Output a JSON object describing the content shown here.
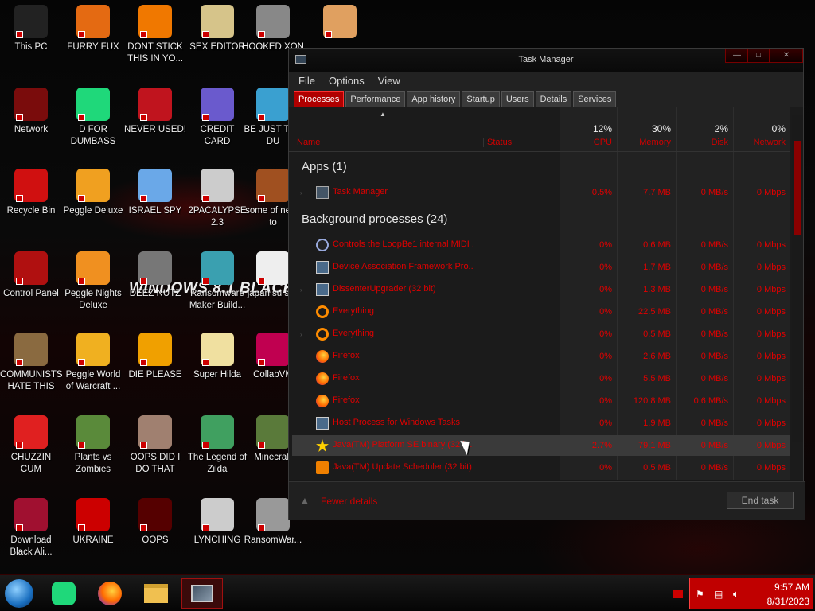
{
  "desktop": {
    "icons": [
      {
        "label": "This PC",
        "col": "#222"
      },
      {
        "label": "FURRY FUX",
        "col": "#e46a12"
      },
      {
        "label": "DONT STICK THIS IN YO...",
        "col": "#f07800"
      },
      {
        "label": "SEX EDITOR",
        "col": "#d6c48a"
      },
      {
        "label": "HOOKED XON",
        "col": "#888"
      },
      {
        "label": "",
        "col": "#e0a060"
      },
      {
        "label": "Network",
        "col": "#7a0c0c"
      },
      {
        "label": "D FOR DUMBASS",
        "col": "#1fd87a"
      },
      {
        "label": "NEVER USED!",
        "col": "#c0141e"
      },
      {
        "label": "CREDIT CARD CHECKER",
        "col": "#6a5acd"
      },
      {
        "label": "BE JUST THE DU",
        "col": "#3aa0d0"
      },
      {
        "label": "Recycle Bin",
        "col": "#d01010"
      },
      {
        "label": "Peggle Deluxe",
        "col": "#f0a020"
      },
      {
        "label": "ISRAEL SPY",
        "col": "#6aa8e8"
      },
      {
        "label": "2PACALYPSE 2.3",
        "col": "#ccc"
      },
      {
        "label": "some of need to",
        "col": "#a05020"
      },
      {
        "label": "Control Panel",
        "col": "#b01010"
      },
      {
        "label": "Peggle Nights Deluxe",
        "col": "#f09020"
      },
      {
        "label": "DEEZ NUTZ",
        "col": "#777"
      },
      {
        "label": "Ransomware Maker Build...",
        "col": "#3aa0b0"
      },
      {
        "label": "japan su sim",
        "col": "#eee"
      },
      {
        "label": "COMMUNISTS HATE THIS G...",
        "col": "#8a6a40"
      },
      {
        "label": "Peggle World of Warcraft ...",
        "col": "#f0b020"
      },
      {
        "label": "DIE PLEASE",
        "col": "#f0a000"
      },
      {
        "label": "Super Hilda",
        "col": "#f0e0a0"
      },
      {
        "label": "CollabVM",
        "col": "#c00050"
      },
      {
        "label": "CHUZZIN CUM",
        "col": "#e02020"
      },
      {
        "label": "Plants vs Zombies",
        "col": "#5a8a3a"
      },
      {
        "label": "OOPS DID I DO THAT",
        "col": "#a08070"
      },
      {
        "label": "The Legend of Zilda",
        "col": "#40a060"
      },
      {
        "label": "Minecraft",
        "col": "#5a7a3a"
      },
      {
        "label": "Download Black Ali...",
        "col": "#a01030"
      },
      {
        "label": "UKRAINE",
        "col": "#c00"
      },
      {
        "label": "OOPS",
        "col": "#500"
      },
      {
        "label": "LYNCHING",
        "col": "#ccc"
      },
      {
        "label": "RansomWar...",
        "col": "#999"
      }
    ],
    "wallpaper_text": "WiNDOWS 8.1 BLACK E"
  },
  "taskmanager": {
    "title": "Task Manager",
    "window_buttons": {
      "min": "—",
      "max": "□",
      "close": "✕"
    },
    "menu": [
      "File",
      "Options",
      "View"
    ],
    "tabs": [
      "Processes",
      "Performance",
      "App history",
      "Startup",
      "Users",
      "Details",
      "Services"
    ],
    "columns": {
      "name": "Name",
      "status": "Status",
      "cpu_pct": "12%",
      "cpu": "CPU",
      "mem_pct": "30%",
      "mem": "Memory",
      "disk_pct": "2%",
      "disk": "Disk",
      "net_pct": "0%",
      "net": "Network"
    },
    "sort_arrow": "▲",
    "apps_header": "Apps (1)",
    "bg_header": "Background processes (24)",
    "apps": [
      {
        "name": "Task Manager",
        "cpu": "0.5%",
        "mem": "7.7 MB",
        "disk": "0 MB/s",
        "net": "0 Mbps",
        "icon": "tm",
        "exp": true
      }
    ],
    "bg": [
      {
        "name": "Controls the LoopBe1 internal MIDI ...",
        "cpu": "0%",
        "mem": "0.6 MB",
        "disk": "0 MB/s",
        "net": "0 Mbps",
        "icon": "midi",
        "exp": false
      },
      {
        "name": "Device Association Framework Pro...",
        "cpu": "0%",
        "mem": "1.7 MB",
        "disk": "0 MB/s",
        "net": "0 Mbps",
        "icon": "win",
        "exp": false
      },
      {
        "name": "DissenterUpgrader (32 bit)",
        "cpu": "0%",
        "mem": "1.3 MB",
        "disk": "0 MB/s",
        "net": "0 Mbps",
        "icon": "win",
        "exp": true
      },
      {
        "name": "Everything",
        "cpu": "0%",
        "mem": "22.5 MB",
        "disk": "0 MB/s",
        "net": "0 Mbps",
        "icon": "search",
        "exp": false
      },
      {
        "name": "Everything",
        "cpu": "0%",
        "mem": "0.5 MB",
        "disk": "0 MB/s",
        "net": "0 Mbps",
        "icon": "search",
        "exp": true
      },
      {
        "name": "Firefox",
        "cpu": "0%",
        "mem": "2.6 MB",
        "disk": "0 MB/s",
        "net": "0 Mbps",
        "icon": "ff",
        "exp": false
      },
      {
        "name": "Firefox",
        "cpu": "0%",
        "mem": "5.5 MB",
        "disk": "0 MB/s",
        "net": "0 Mbps",
        "icon": "ff",
        "exp": false
      },
      {
        "name": "Firefox",
        "cpu": "0%",
        "mem": "120.8 MB",
        "disk": "0.6 MB/s",
        "net": "0 Mbps",
        "icon": "ff",
        "exp": false
      },
      {
        "name": "Host Process for Windows Tasks",
        "cpu": "0%",
        "mem": "1.9 MB",
        "disk": "0 MB/s",
        "net": "0 Mbps",
        "icon": "win",
        "exp": false
      },
      {
        "name": "Java(TM) Platform SE binary (32 b...",
        "cpu": "2.7%",
        "mem": "79.1 MB",
        "disk": "0 MB/s",
        "net": "0 Mbps",
        "icon": "star",
        "exp": false,
        "hl": true
      },
      {
        "name": "Java(TM) Update Scheduler (32 bit)",
        "cpu": "0%",
        "mem": "0.5 MB",
        "disk": "0 MB/s",
        "net": "0 Mbps",
        "icon": "java",
        "exp": false
      }
    ],
    "fewer_details": "Fewer details",
    "end_task": "End task"
  },
  "taskbar": {
    "time": "9:57 AM",
    "date": "8/31/2023"
  }
}
